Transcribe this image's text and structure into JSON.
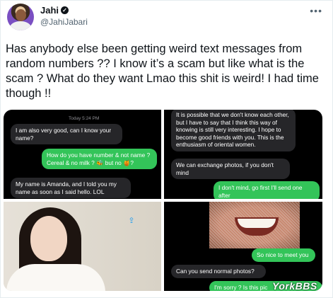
{
  "author": {
    "name": "Jahi",
    "handle": "@JahiJabari",
    "verified_icon": "verified-badge-icon"
  },
  "more_icon": "more-horizontal-icon",
  "tweet_text": "Has anybody else been getting weird text messages from random numbers ?? I know it’s a scam but like what is the scam ? What do they want Lmao this shit is weird! I had time though !!",
  "media": {
    "screenshot1": {
      "timestamp": "Today 5:24 PM",
      "msg1": "I am also very good, can I know your name?",
      "msg2": "How do you have number & not name ? Cereal & no milk ? 🐝 but no 🍯?",
      "msg3": "My name is Amanda, and I told you my name as soon as I said hello. LOL"
    },
    "screenshot2": {
      "msg1": "It is possible that we don't know each other, but I have to say that I think this way of knowing is still very interesting. I hope to become good friends with you. This is the enthusiasm of oriental women.",
      "msg2": "We can exchange photos, if you don't mind",
      "msg3": "I don't mind, go first I'll send one after"
    },
    "photo": {
      "share_icon": "share-icon"
    },
    "screenshot4": {
      "msg1": "So nice to meet you",
      "msg2": "Can you send normal photos?",
      "msg3": "I'm sorry ? Is this pic"
    }
  },
  "watermark": "YorkBBS",
  "colors": {
    "imessage_green": "#33c459",
    "bubble_gray": "#262629",
    "link_blue": "#1d9bf0"
  }
}
